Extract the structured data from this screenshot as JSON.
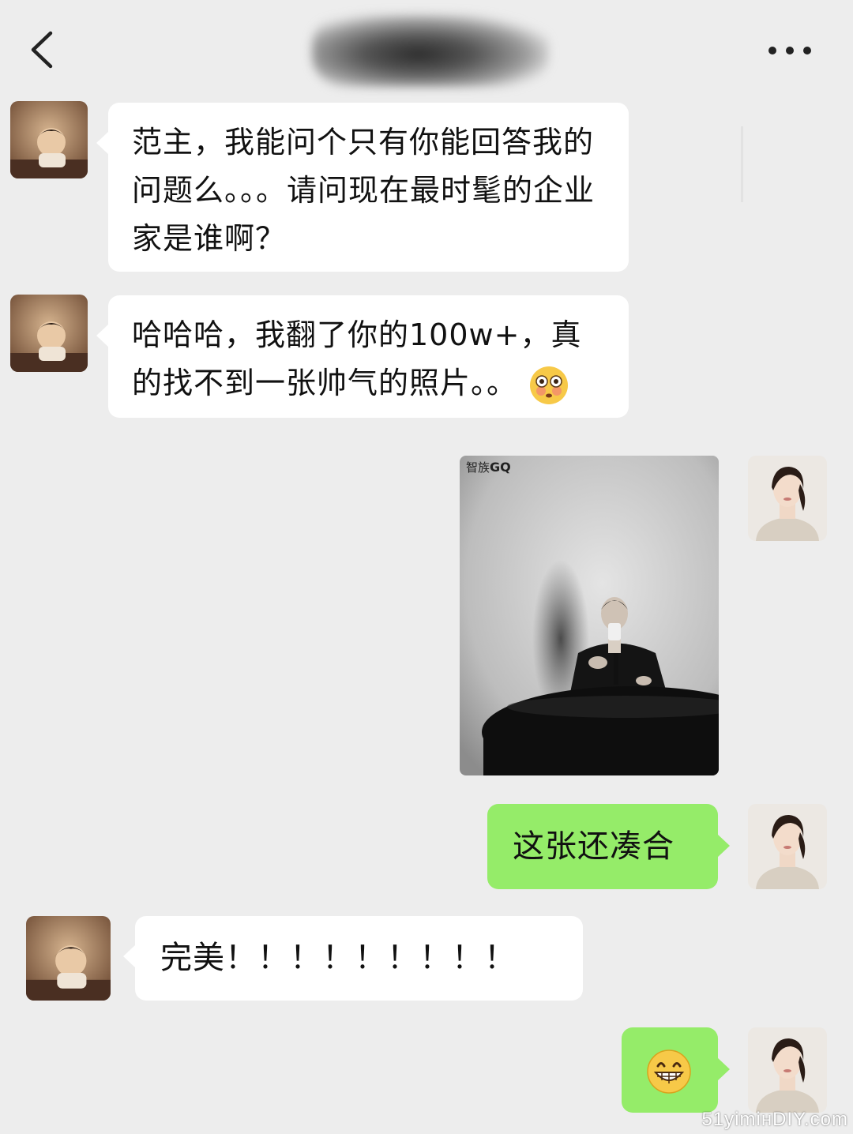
{
  "header": {
    "title": "",
    "back_icon": "chevron-left-icon",
    "more_icon": "more-dots-icon"
  },
  "messages": [
    {
      "from": "other",
      "text": "范主，我能问个只有你能回答我的问题么。。。请问现在最时髦的企业家是谁啊？"
    },
    {
      "from": "other",
      "text": "哈哈哈，我翻了你的100w+，真的找不到一张帅气的照片。。",
      "emoji": "flushed-face-emoji"
    },
    {
      "from": "me",
      "type": "image",
      "caption_cn": "智族",
      "caption_brand": "GQ"
    },
    {
      "from": "me",
      "text": "这张还凑合"
    },
    {
      "from": "other",
      "text": "完美！！！！！！！！！"
    },
    {
      "from": "me",
      "type": "emoji",
      "emoji": "grinning-face-emoji"
    }
  ],
  "watermark": "51yimінDIY.com",
  "colors": {
    "background": "#ededed",
    "incoming_bubble": "#ffffff",
    "outgoing_bubble": "#95ec69"
  }
}
